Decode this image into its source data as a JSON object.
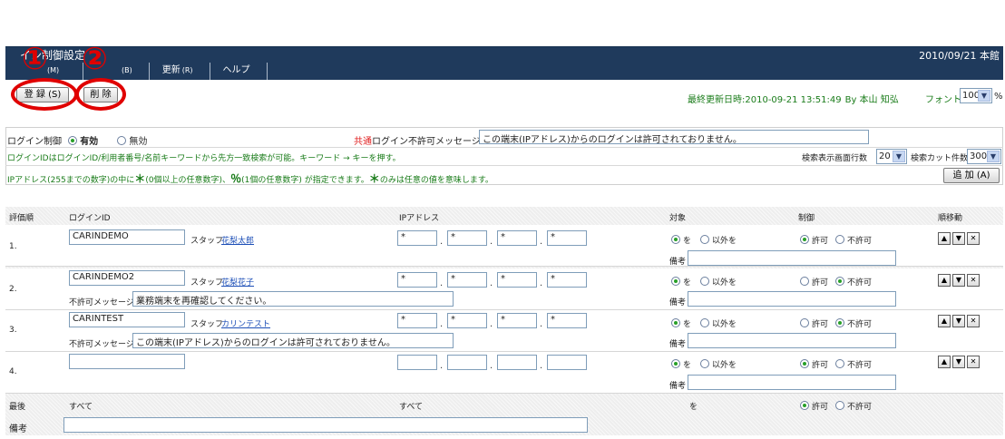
{
  "window": {
    "title": "ログイン制御設定",
    "title_visible": "イン制御設定",
    "date_location": "2010/09/21 本館"
  },
  "menu": [
    {
      "label": "メニュー",
      "acc": "(M)"
    },
    {
      "label": "戻る",
      "acc": "(B)"
    },
    {
      "label": "更新",
      "acc": "(R)"
    },
    {
      "label": "ヘルプ",
      "acc": ""
    }
  ],
  "callouts": {
    "one": "①",
    "two": "②"
  },
  "toolbar": {
    "register_label": "登 録 (S)",
    "delete_label": "削 除",
    "last_update_prefix": "最終更新日時:",
    "last_update_value": "2010-09-21 13:51:49",
    "last_update_by": "By 本山 知弘",
    "font_label": "フォント",
    "font_value": "100",
    "font_unit": "%"
  },
  "settings": {
    "login_control_label": "ログイン制御",
    "enabled_label": "有効",
    "disabled_label": "無効",
    "common_label_red": "共通",
    "deny_message_label": "ログイン不許可メッセージ",
    "deny_message_value": "この端末(IPアドレス)からのログインは許可されておりません。",
    "search_help": "ログインIDはログインID/利用者番号/名前キーワードから先方一致検索が可能。キーワード → キーを押す。",
    "rows_label": "検索表示画面行数",
    "rows_value": "20",
    "cut_label": "検索カット件数",
    "cut_value": "300",
    "ip_help_1": "IPアドレス(255までの数字)の中に",
    "ip_help_2": "(0個以上の任意数字)、",
    "ip_help_3": "(1個の任意数字) が指定できます。",
    "ip_help_4": "のみは任意の値を意味します。",
    "asterisk": "＊",
    "percent": "％",
    "add_label": "追 加 (A)"
  },
  "grid": {
    "headers": {
      "order": "評価順",
      "login_id": "ログインID",
      "ip": "IPアドレス",
      "target": "対象",
      "control": "制御",
      "move": "順移動"
    },
    "target_opts": {
      "is": "を",
      "not": "以外を"
    },
    "control_opts": {
      "allow": "許可",
      "deny": "不許可"
    },
    "remarks_label": "備考",
    "deny_msg_label": "不許可メッセージ",
    "rows": [
      {
        "num": "1.",
        "login_id": "CARINDEMO",
        "staff_label": "スタッフ",
        "staff_name": "花梨太郎",
        "ip": [
          "*",
          "*",
          "*",
          "*"
        ],
        "target": "is",
        "control": "allow",
        "deny_msg": ""
      },
      {
        "num": "2.",
        "login_id": "CARINDEMO2",
        "staff_label": "スタッフ",
        "staff_name": "花梨花子",
        "ip": [
          "*",
          "*",
          "*",
          "*"
        ],
        "target": "is",
        "control": "deny",
        "deny_msg": "業務端末を再確認してください。"
      },
      {
        "num": "3.",
        "login_id": "CARINTEST",
        "staff_label": "スタッフ",
        "staff_name": "カリンテスト",
        "ip": [
          "*",
          "*",
          "*",
          "*"
        ],
        "target": "is",
        "control": "deny",
        "deny_msg": "この端末(IPアドレス)からのログインは許可されておりません。"
      },
      {
        "num": "4.",
        "login_id": "",
        "staff_label": "",
        "staff_name": "",
        "ip": [
          "",
          "",
          "",
          ""
        ],
        "target": "is",
        "control": "allow",
        "deny_msg": ""
      }
    ],
    "last_row": {
      "label": "最後",
      "login_all": "すべて",
      "ip_all": "すべて",
      "target": "を",
      "control": "allow"
    },
    "footer_remarks_label": "備考"
  }
}
